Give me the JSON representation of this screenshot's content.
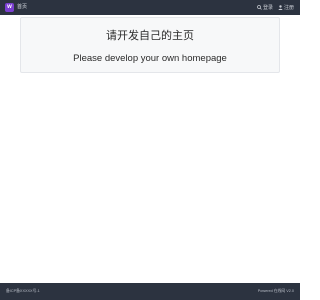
{
  "navbar": {
    "brand_icon": "brand-logo-icon",
    "brand_letter": "w",
    "home_label": "首页",
    "login_label": "登录",
    "login_icon": "login-icon",
    "register_label": "注册",
    "register_icon": "user-icon",
    "bg_color": "#2c3340",
    "brand_color": "#7b3fd1"
  },
  "main": {
    "title": "请开发自己的主页",
    "subtitle": "Please develop your own homepage"
  },
  "footer": {
    "left_text": "备ICP备XXXXX号-1",
    "right_text": "Powered 在线网 V2.0"
  }
}
